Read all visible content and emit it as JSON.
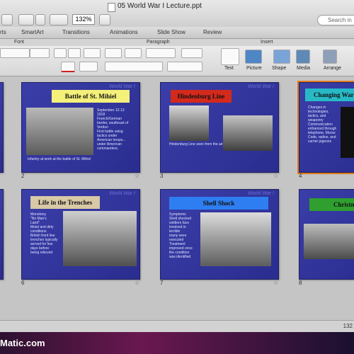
{
  "window": {
    "title": "05 World War I Lecture.ppt",
    "zoom": "132%",
    "search_placeholder": "Search in"
  },
  "ribbon_tabs": [
    "rts",
    "SmartArt",
    "Transitions",
    "Animations",
    "Slide Show",
    "Review"
  ],
  "ribbon_groups": {
    "font": "Font",
    "paragraph": "Paragraph",
    "insert": "Insert"
  },
  "ribbon_buttons": {
    "text": "Text",
    "picture": "Picture",
    "shape": "Shape",
    "media": "Media",
    "arrange": "Arrange"
  },
  "slides": [
    {
      "num": "2",
      "title": "Battle of St. Mihiel",
      "bullets": "September 12-13\n1918\nFrench/German\nborder, southeast of\nVerdun\nFirst battle using\ntactics under\nAmerican troops...\nunder American\ncommanders.",
      "caption": "Infantry at work at the battle of St. Mihiel"
    },
    {
      "num": "3",
      "title": "Hindenburg Line",
      "caption": "Hindenburg Line seen from the air"
    },
    {
      "num": "4",
      "title": "Changing War",
      "bullets": "Changes in\ntechnologies,\ntactics, and\nweaponry\nCommunication\nenhanced through\ntelephone, Morse\nCode, radios, and\ncarrier pigeons"
    },
    {
      "num": "6",
      "title": "Life in the Trenches",
      "bullets": "Monotony\n\"No Man's\nLand\"\nMoist and dirty\nconditions\nBritish front line\ntrenches typically\nserved for few\ndays before\nbeing relieved"
    },
    {
      "num": "7",
      "title": "Shell Shock",
      "bullets": "Symptoms\nShell shocked\nsoldiers face\ninvolved in\nterrible\nmany were\nexecuted\nTreatment\nimproved once\nthe condition\nwas identified"
    },
    {
      "num": "8",
      "title": "Christmas"
    }
  ],
  "watermark": "Matic.com",
  "status_zoom": "132"
}
